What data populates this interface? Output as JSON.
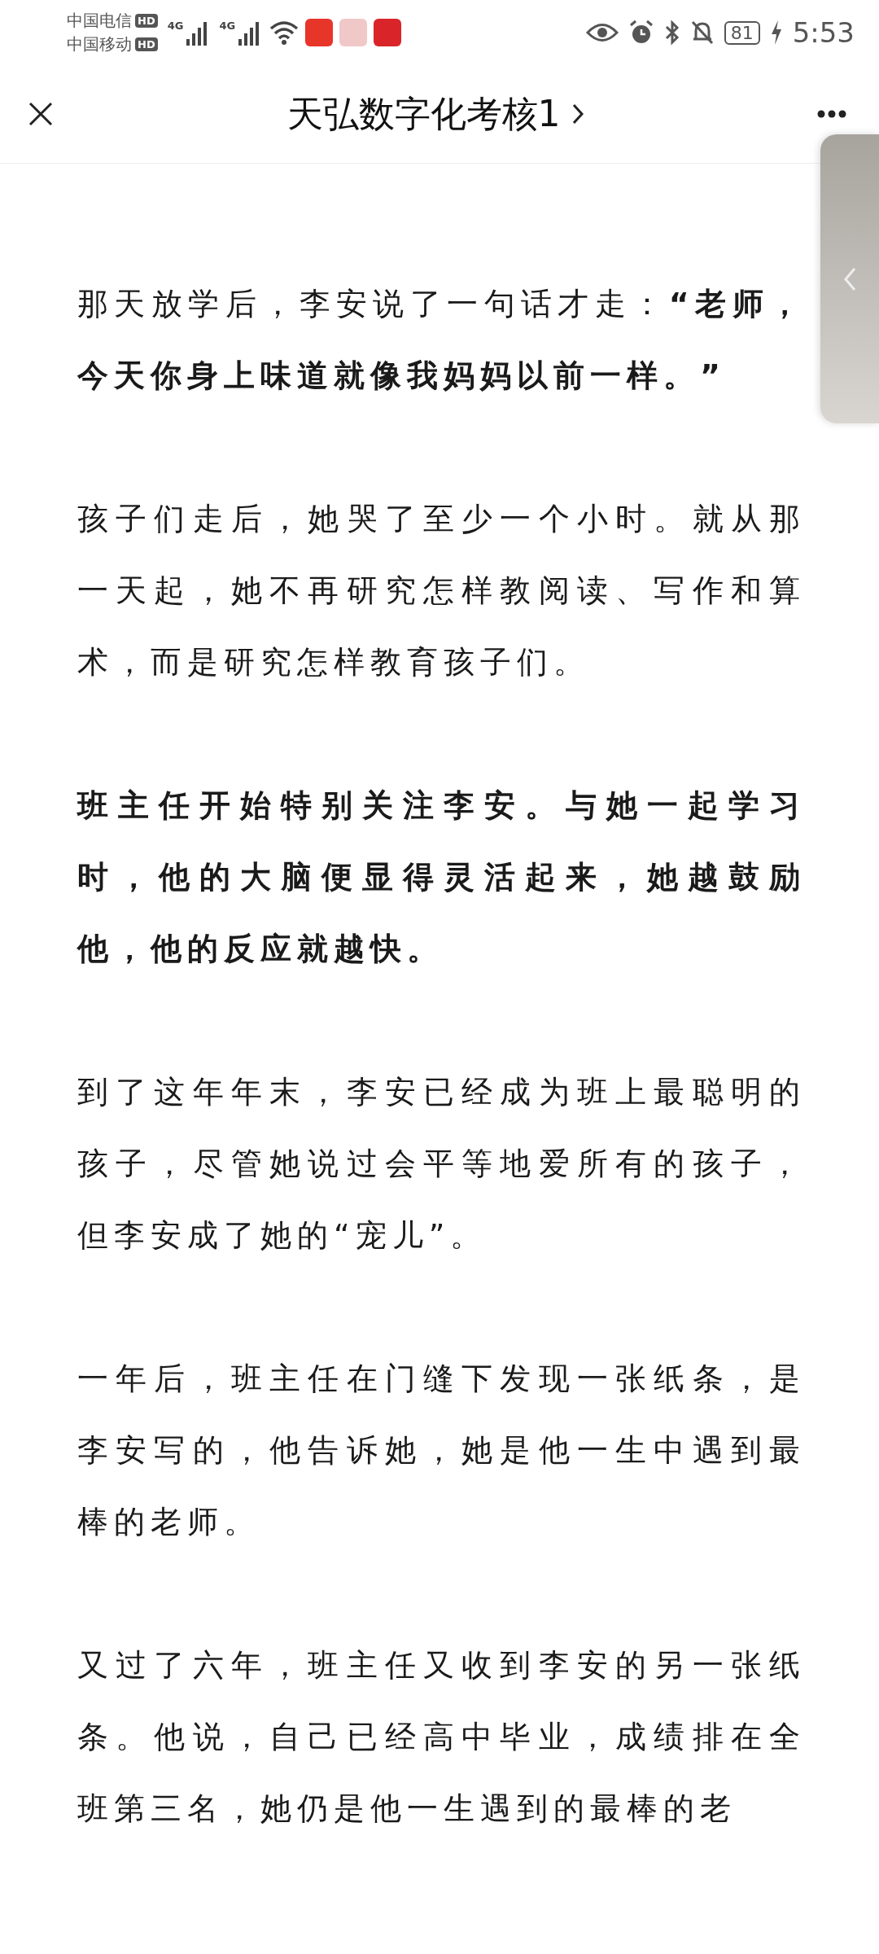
{
  "status_bar": {
    "carriers": [
      {
        "name": "中国电信",
        "badge": "HD"
      },
      {
        "name": "中国移动",
        "badge": "HD"
      }
    ],
    "network": [
      "4G",
      "4G"
    ],
    "battery": "81",
    "time": "5:53"
  },
  "header": {
    "title": "天弘数字化考核1"
  },
  "paragraphs": [
    {
      "kind": "plain",
      "text": "那天放学后，李安说了一句话才走：**“老师，今天你身上味道就像我妈妈以前一样。”**"
    },
    {
      "kind": "plain",
      "text": "孩子们走后，她哭了至少一个小时。就从那一天起，她不再研究怎样教阅读、写作和算术，而是研究怎样教育孩子们。"
    },
    {
      "kind": "bold",
      "text": "班主任开始特别关注李安。与她一起学习时，他的大脑便显得灵活起来，她越鼓励他，他的反应就越快。"
    },
    {
      "kind": "plain",
      "text": "到了这年年末，李安已经成为班上最聪明的孩子，尽管她说过会平等地爱所有的孩子，但李安成了她的“宠儿”。"
    },
    {
      "kind": "plain",
      "text": "一年后，班主任在门缝下发现一张纸条，是李安写的，他告诉她，她是他一生中遇到最棒的老师。"
    },
    {
      "kind": "plain",
      "text": "又过了六年，班主任又收到李安的另一张纸条。他说，自己已经高中毕业，成绩排在全班第三名，她仍是他一生遇到的最棒的老"
    }
  ]
}
